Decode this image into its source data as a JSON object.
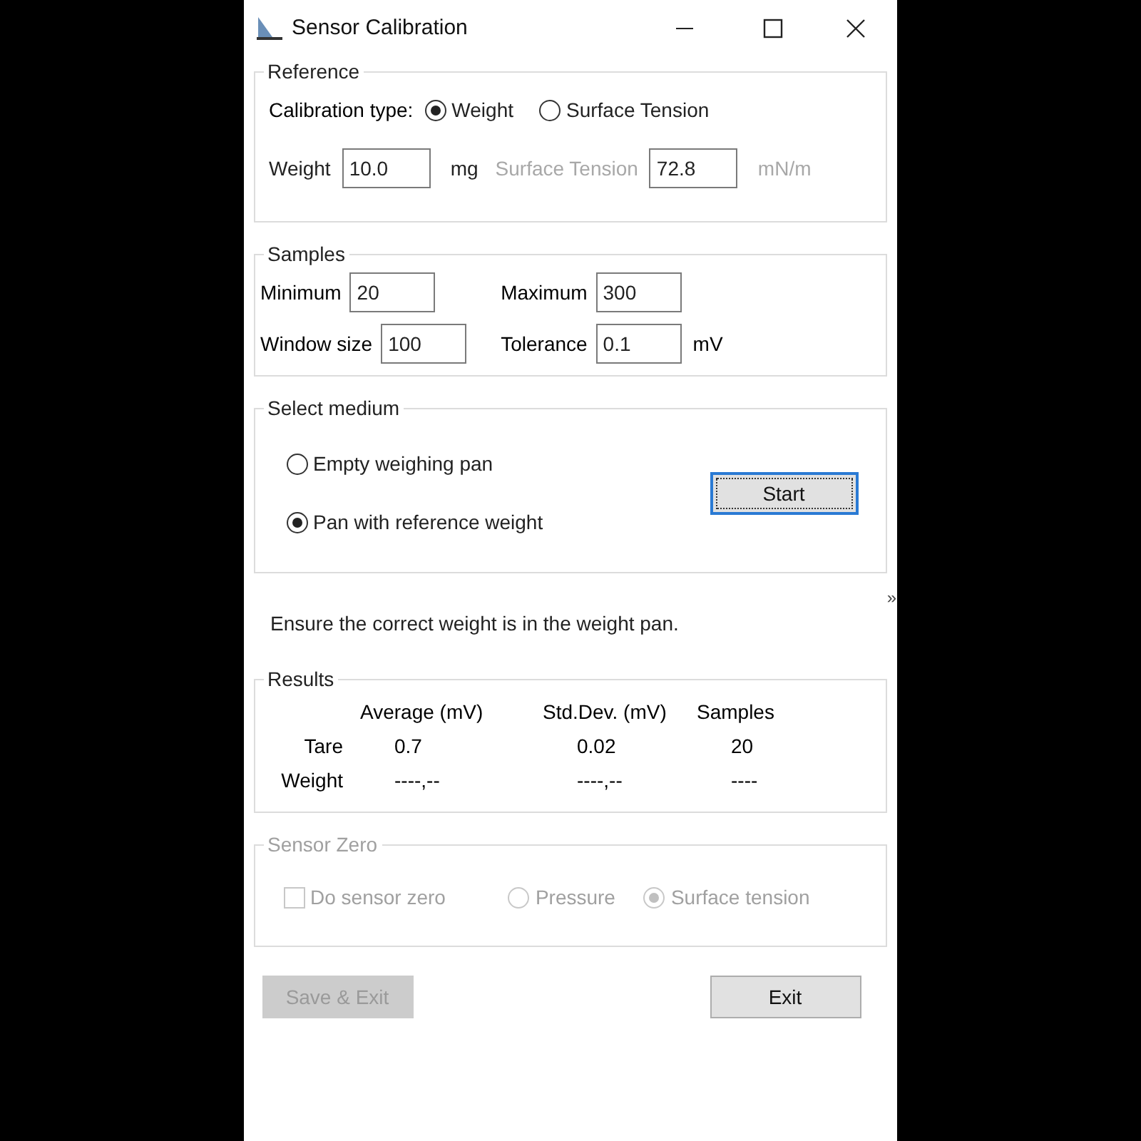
{
  "window": {
    "title": "Sensor Calibration"
  },
  "reference": {
    "title": "Reference",
    "calibration_type_label": "Calibration type:",
    "options": [
      {
        "label": "Weight",
        "selected": true
      },
      {
        "label": "Surface Tension",
        "selected": false
      }
    ],
    "fields": [
      {
        "label": "Weight",
        "value": "10.0",
        "unit": "mg",
        "disabled": false
      },
      {
        "label": "Surface Tension",
        "value": "72.8",
        "unit": "mN/m",
        "disabled": true
      }
    ]
  },
  "samples": {
    "title": "Samples",
    "fields": [
      {
        "label": "Minimum",
        "value": "20"
      },
      {
        "label": "Maximum",
        "value": "300"
      },
      {
        "label": "Window size",
        "value": "100"
      },
      {
        "label": "Tolerance",
        "value": "0.1",
        "unit": "mV"
      }
    ]
  },
  "medium": {
    "title": "Select medium",
    "options": [
      {
        "label": "Empty weighing pan",
        "selected": false
      },
      {
        "label": "Pan with reference weight",
        "selected": true
      }
    ],
    "start_button": "Start"
  },
  "expand_glyph": "»",
  "message": "Ensure the correct weight is in the weight pan.",
  "results": {
    "title": "Results",
    "columns": [
      "Average (mV)",
      "Std.Dev. (mV)",
      "Samples"
    ],
    "rows": [
      {
        "label": "Tare",
        "cells": [
          "0.7",
          "0.02",
          "20"
        ]
      },
      {
        "label": "Weight",
        "cells": [
          "----,--",
          "----,--",
          "----"
        ]
      }
    ]
  },
  "sensor_zero": {
    "title": "Sensor Zero",
    "disabled": true,
    "checkbox": {
      "label": "Do sensor zero",
      "checked": false
    },
    "options": [
      {
        "label": "Pressure",
        "selected": false
      },
      {
        "label": "Surface tension",
        "selected": true
      }
    ]
  },
  "buttons": [
    {
      "label": "Save & Exit",
      "disabled": true
    },
    {
      "label": "Exit",
      "disabled": false
    }
  ]
}
